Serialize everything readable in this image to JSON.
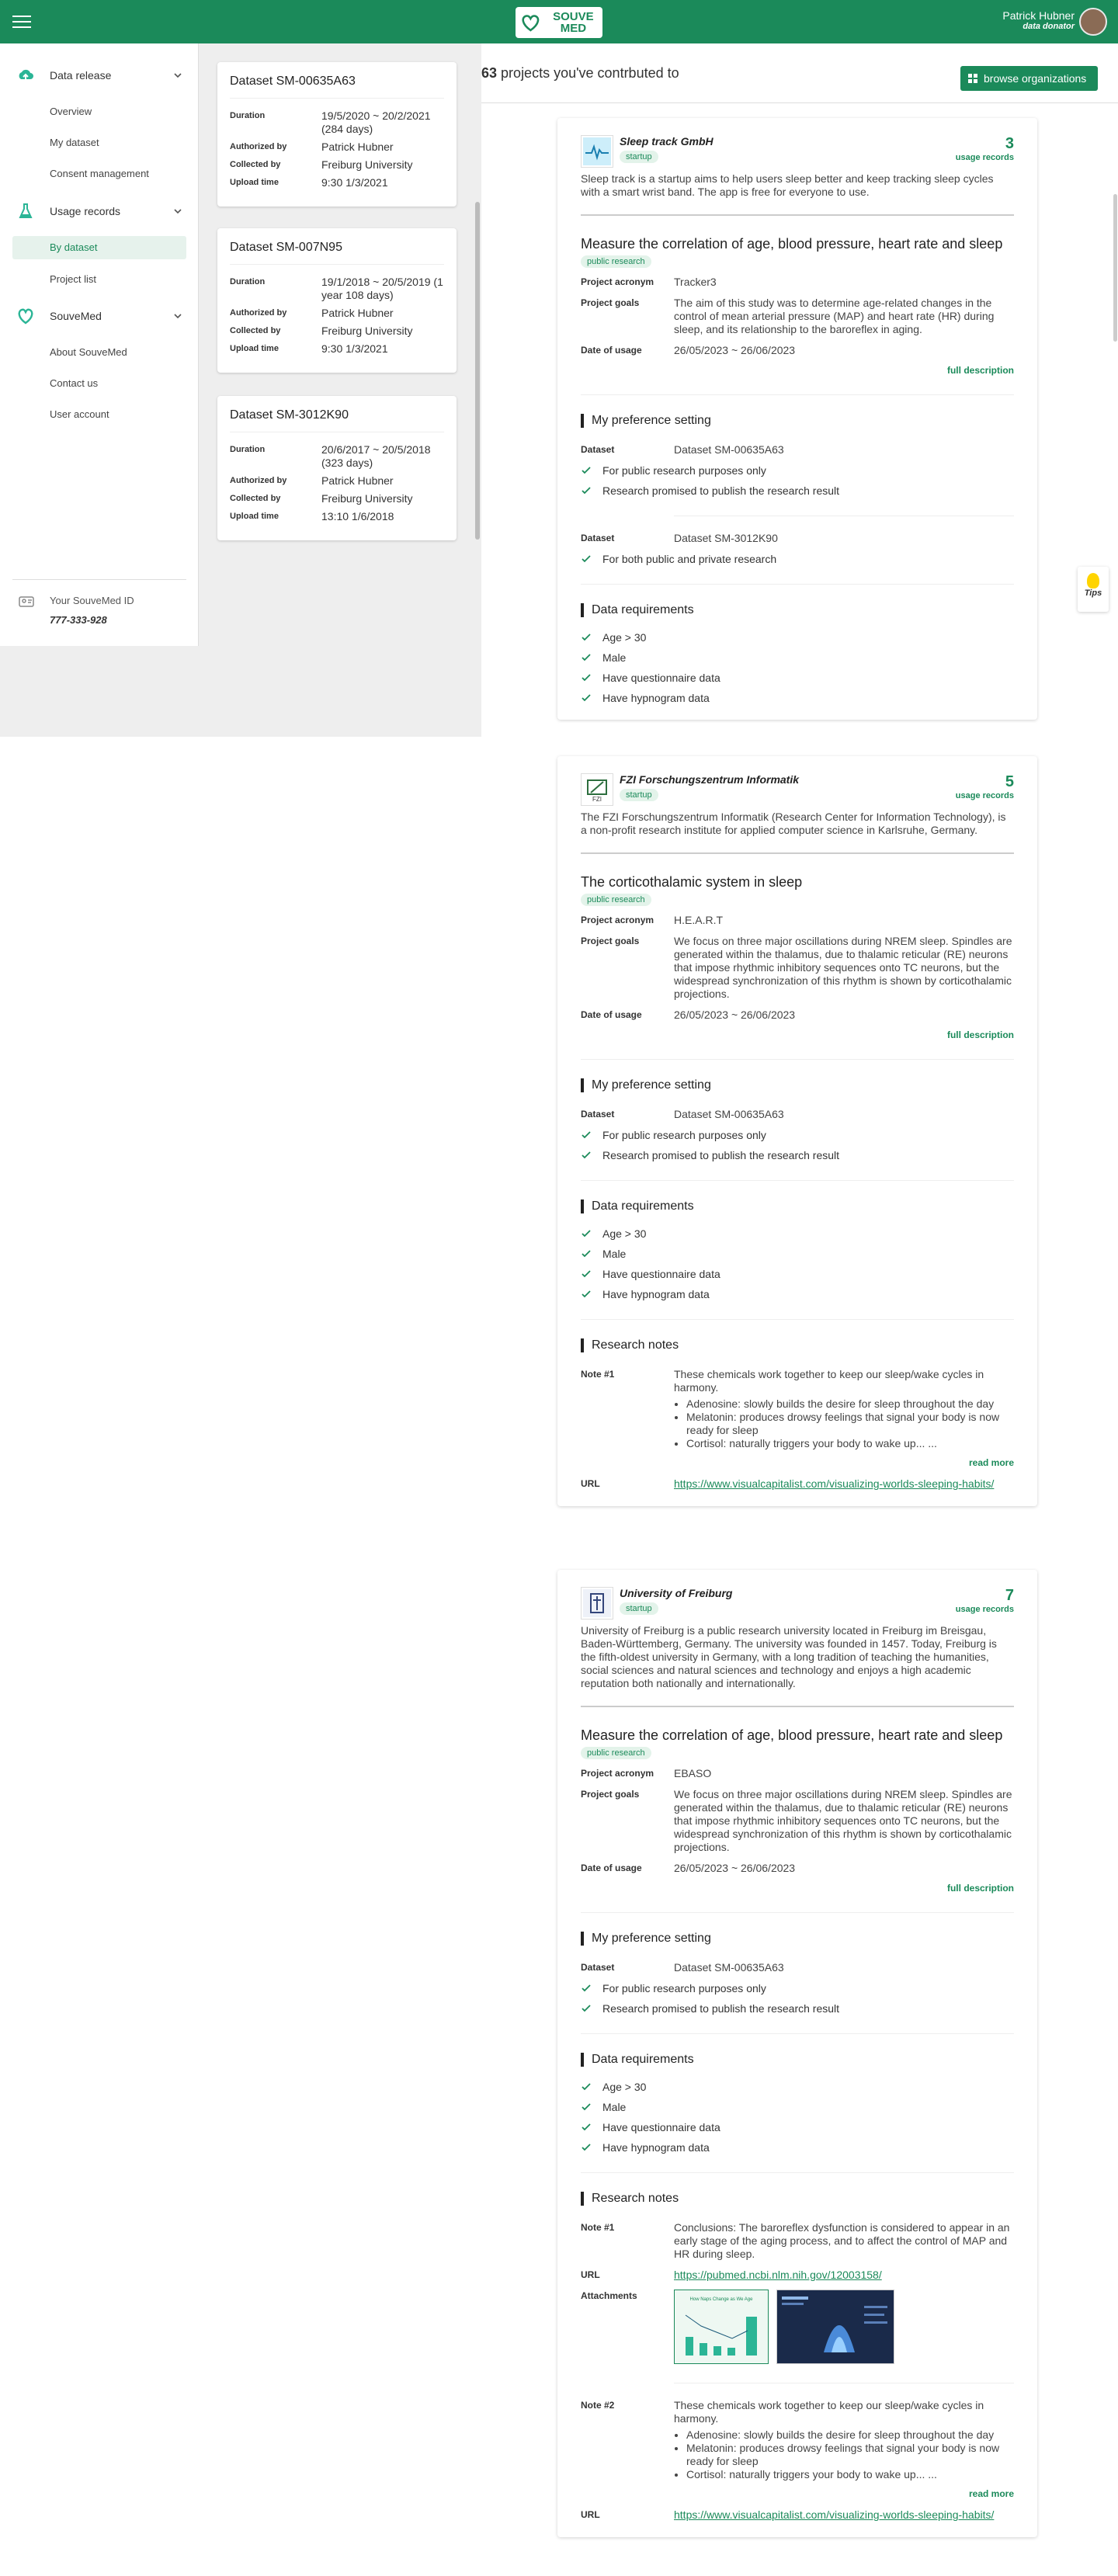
{
  "topbar": {
    "logo_text": "SOUVE MED",
    "user_name": "Patrick Hubner",
    "user_role": "data donator"
  },
  "sidebar": {
    "groups": [
      {
        "label": "Data release",
        "items": [
          "Overview",
          "My dataset",
          "Consent management"
        ]
      },
      {
        "label": "Usage records",
        "items": [
          "By dataset",
          "Project list"
        ]
      },
      {
        "label": "SouveMed",
        "items": [
          "About SouveMed",
          "Contact us",
          "User account"
        ]
      }
    ],
    "id_label": "Your SouveMed ID",
    "id_value": "777-333-928"
  },
  "datasets": [
    {
      "title": "Dataset SM-00635A63",
      "rows": [
        [
          "Duration",
          "19/5/2020 ~ 20/2/2021 (284 days)"
        ],
        [
          "Authorized by",
          "Patrick Hubner"
        ],
        [
          "Collected by",
          "Freiburg University"
        ],
        [
          "Upload time",
          "9:30 1/3/2021"
        ]
      ]
    },
    {
      "title": "Dataset SM-007N95",
      "rows": [
        [
          "Duration",
          "19/1/2018 ~ 20/5/2019 (1 year 108 days)"
        ],
        [
          "Authorized by",
          "Patrick Hubner"
        ],
        [
          "Collected by",
          "Freiburg University"
        ],
        [
          "Upload time",
          "9:30 1/3/2021"
        ]
      ]
    },
    {
      "title": "Dataset SM-3012K90",
      "rows": [
        [
          "Duration",
          "20/6/2017 ~ 20/5/2018 (323 days)"
        ],
        [
          "Authorized by",
          "Patrick Hubner"
        ],
        [
          "Collected by",
          "Freiburg University"
        ],
        [
          "Upload time",
          "13:10 1/6/2018"
        ]
      ]
    }
  ],
  "main": {
    "count": "63",
    "count_label": "projects you've contrbuted to",
    "browse_label": "browse organizations",
    "tips_label": "Tips"
  },
  "labels": {
    "usage": "usage records",
    "acronym": "Project acronym",
    "goals": "Project goals",
    "date": "Date of usage",
    "full": "full description",
    "pref": "My preference setting",
    "dataset": "Dataset",
    "req": "Data requirements",
    "notes": "Research notes",
    "url": "URL",
    "attachments": "Attachments",
    "readmore": "read more"
  },
  "projects": [
    {
      "org": "Sleep track GmbH",
      "tag": "startup",
      "count": "3",
      "desc": "Sleep track is a startup aims to help users sleep better and keep tracking sleep cycles with a smart wrist band. The app is free for everyone to use.",
      "title": "Measure the correlation of age, blood pressure, heart rate and sleep",
      "ptag": "public research",
      "acronym": "Tracker3",
      "goals": "The aim of this study was to determine age-related changes in the control of mean arterial pressure (MAP) and heart rate (HR) during sleep, and its relationship to the baroreflex in aging.",
      "date": "26/05/2023 ~ 26/06/2023",
      "prefs": [
        {
          "dataset": "Dataset SM-00635A63",
          "items": [
            "For public research purposes only",
            "Research promised to publish the research result"
          ]
        },
        {
          "dataset": "Dataset SM-3012K90",
          "items": [
            "For both public and private research"
          ]
        }
      ],
      "reqs": [
        "Age > 30",
        "Male",
        "Have questionnaire data",
        "Have hypnogram data"
      ]
    },
    {
      "org": "FZI Forschungszentrum Informatik",
      "tag": "startup",
      "count": "5",
      "desc": "The FZI Forschungszentrum Informatik (Research Center for Information Technology), is a non-profit research institute for applied computer science in Karlsruhe, Germany.",
      "title": "The corticothalamic system in sleep",
      "ptag": "public research",
      "acronym": "H.E.A.R.T",
      "goals": "We focus on three major oscillations during NREM sleep. Spindles are generated within the thalamus, due to thalamic reticular (RE) neurons that impose rhythmic inhibitory sequences onto TC neurons, but the widespread synchronization of this rhythm is shown by corticothalamic projections.",
      "date": "26/05/2023 ~ 26/06/2023",
      "prefs": [
        {
          "dataset": "Dataset SM-00635A63",
          "items": [
            "For public research purposes only",
            "Research promised to publish the research result"
          ]
        }
      ],
      "reqs": [
        "Age > 30",
        "Male",
        "Have questionnaire data",
        "Have hypnogram data"
      ],
      "notes": [
        {
          "label": "Note #1",
          "text": "These chemicals work together to keep our sleep/wake cycles in harmony.",
          "bullets": [
            "Adenosine: slowly builds the desire for sleep throughout the day",
            "Melatonin: produces drowsy feelings that signal your body is now ready for sleep",
            "Cortisol: naturally triggers your body to wake up... ..."
          ],
          "url": "https://www.visualcapitalist.com/visualizing-worlds-sleeping-habits/"
        }
      ]
    },
    {
      "org": "University of Freiburg",
      "tag": "startup",
      "count": "7",
      "desc": "University of Freiburg is a public research university located in Freiburg im Breisgau, Baden-Württemberg, Germany. The university was founded in 1457. Today, Freiburg is the fifth-oldest university in Germany, with a long tradition of teaching the humanities, social sciences and natural sciences and technology and enjoys a high academic reputation both nationally and internationally.",
      "title": "Measure the correlation of age, blood pressure, heart rate and sleep",
      "ptag": "public research",
      "acronym": "EBASO",
      "goals": "We focus on three major oscillations during NREM sleep. Spindles are generated within the thalamus, due to thalamic reticular (RE) neurons that impose rhythmic inhibitory sequences onto TC neurons, but the widespread synchronization of this rhythm is shown by corticothalamic projections.",
      "date": "26/05/2023 ~ 26/06/2023",
      "prefs": [
        {
          "dataset": "Dataset SM-00635A63",
          "items": [
            "For public research purposes only",
            "Research promised to publish the research result"
          ]
        }
      ],
      "reqs": [
        "Age > 30",
        "Male",
        "Have questionnaire data",
        "Have hypnogram data"
      ],
      "notes": [
        {
          "label": "Note #1",
          "text": "Conclusions: The baroreflex dysfunction is considered to appear in an early stage of the aging process, and to affect the control of MAP and HR during sleep.",
          "url": "https://pubmed.ncbi.nlm.nih.gov/12003158/",
          "attachments": [
            "How Naps Change as We Age"
          ]
        },
        {
          "label": "Note #2",
          "text": "These chemicals work together to keep our sleep/wake cycles in harmony.",
          "bullets": [
            "Adenosine: slowly builds the desire for sleep throughout the day",
            "Melatonin: produces drowsy feelings that signal your body is now ready for sleep",
            "Cortisol: naturally triggers your body to wake up... ..."
          ],
          "url": "https://www.visualcapitalist.com/visualizing-worlds-sleeping-habits/"
        }
      ]
    }
  ]
}
